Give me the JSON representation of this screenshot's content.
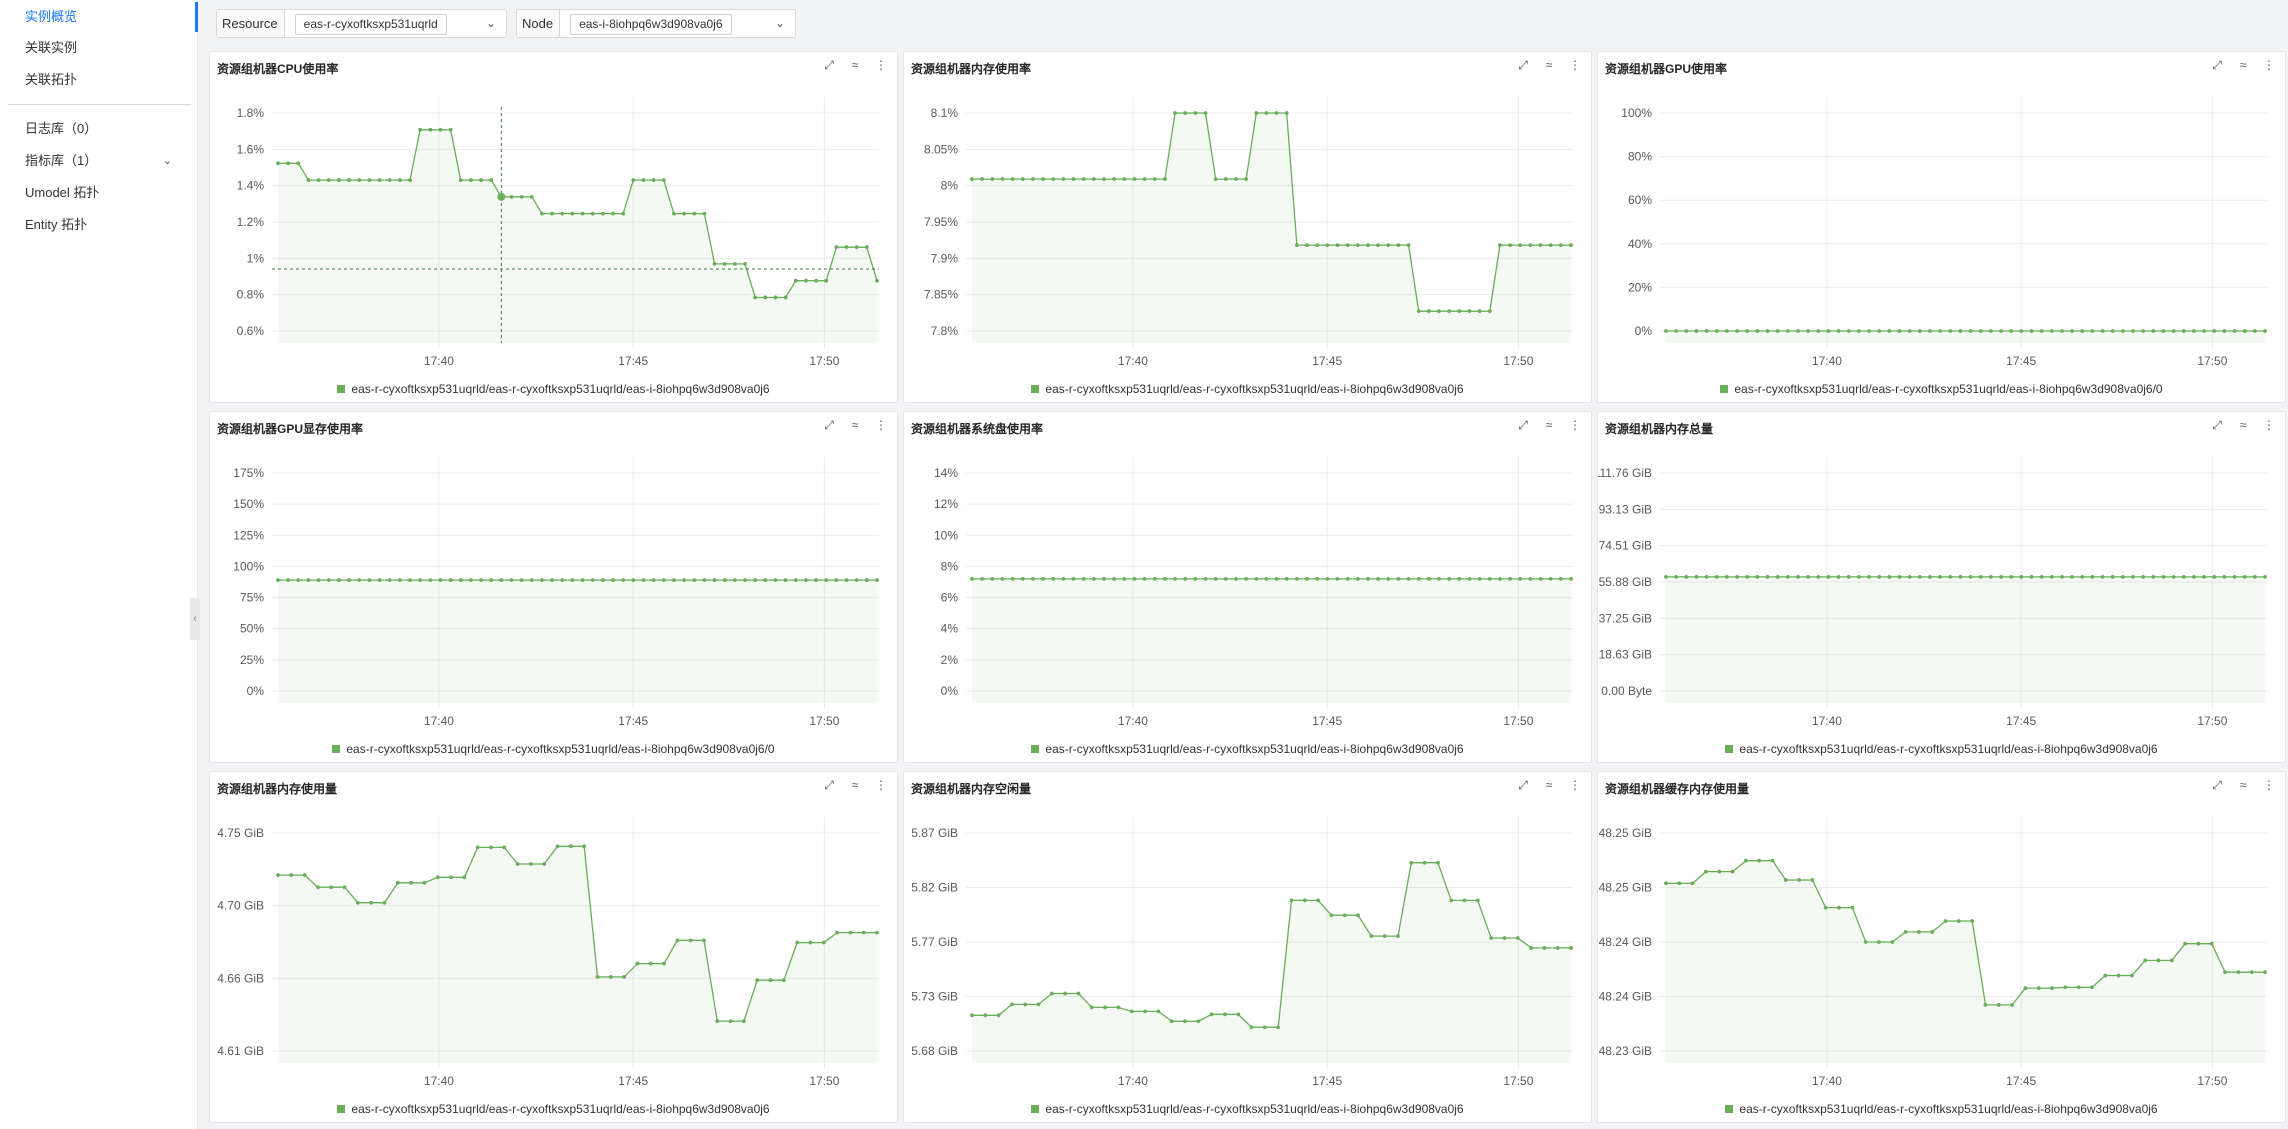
{
  "sidebar": {
    "items": [
      {
        "label": "实例概览",
        "active": true
      },
      {
        "label": "关联实例"
      },
      {
        "label": "关联拓扑"
      },
      {
        "label": "日志库（0）"
      },
      {
        "label": "指标库（1）",
        "expandable": true
      },
      {
        "label": "Umodel 拓扑"
      },
      {
        "label": "Entity 拓扑"
      }
    ]
  },
  "filters": {
    "resource": {
      "label": "Resource",
      "value": "eas-r-cyxoftksxp531uqrld"
    },
    "node": {
      "label": "Node",
      "value": "eas-i-8iohpq6w3d908va0j6"
    }
  },
  "panel_tools": [
    "expand-icon",
    "trend-icon",
    "more-icon"
  ],
  "colors": {
    "series": "#6aad5b",
    "accent": "#1677ff"
  },
  "panels": [
    {
      "title": "资源组机器CPU使用率",
      "legend": "eas-r-cyxoftksxp531uqrld/eas-r-cyxoftksxp531uqrld/eas-i-8iohpq6w3d908va0j6"
    },
    {
      "title": "资源组机器内存使用率",
      "legend": "eas-r-cyxoftksxp531uqrld/eas-r-cyxoftksxp531uqrld/eas-i-8iohpq6w3d908va0j6"
    },
    {
      "title": "资源组机器GPU使用率",
      "legend": "eas-r-cyxoftksxp531uqrld/eas-r-cyxoftksxp531uqrld/eas-i-8iohpq6w3d908va0j6/0"
    },
    {
      "title": "资源组机器GPU显存使用率",
      "legend": "eas-r-cyxoftksxp531uqrld/eas-r-cyxoftksxp531uqrld/eas-i-8iohpq6w3d908va0j6/0"
    },
    {
      "title": "资源组机器系统盘使用率",
      "legend": "eas-r-cyxoftksxp531uqrld/eas-r-cyxoftksxp531uqrld/eas-i-8iohpq6w3d908va0j6"
    },
    {
      "title": "资源组机器内存总量",
      "legend": "eas-r-cyxoftksxp531uqrld/eas-r-cyxoftksxp531uqrld/eas-i-8iohpq6w3d908va0j6"
    },
    {
      "title": "资源组机器内存使用量",
      "legend": "eas-r-cyxoftksxp531uqrld/eas-r-cyxoftksxp531uqrld/eas-i-8iohpq6w3d908va0j6"
    },
    {
      "title": "资源组机器内存空闲量",
      "legend": "eas-r-cyxoftksxp531uqrld/eas-r-cyxoftksxp531uqrld/eas-i-8iohpq6w3d908va0j6"
    },
    {
      "title": "资源组机器缓存内存使用量",
      "legend": "eas-r-cyxoftksxp531uqrld/eas-r-cyxoftksxp531uqrld/eas-i-8iohpq6w3d908va0j6"
    }
  ],
  "chart_data": [
    {
      "type": "area",
      "title": "资源组机器CPU使用率",
      "x": {
        "ticks": [
          "17:40",
          "17:45",
          "17:50"
        ]
      },
      "yticks": [
        "0.6%",
        "0.8%",
        "1%",
        "1.2%",
        "1.4%",
        "1.6%",
        "1.8%"
      ],
      "ylim": [
        0.5,
        1.8
      ],
      "series": [
        {
          "name": "eas-r-cyxoftksxp531uqrld/eas-r-cyxoftksxp531uqrld/eas-i-8iohpq6w3d908va0j6",
          "values": [
            1.5,
            1.5,
            1.5,
            1.4,
            1.4,
            1.4,
            1.4,
            1.4,
            1.4,
            1.4,
            1.4,
            1.4,
            1.4,
            1.4,
            1.7,
            1.7,
            1.7,
            1.7,
            1.4,
            1.4,
            1.4,
            1.4,
            1.3,
            1.3,
            1.3,
            1.3,
            1.2,
            1.2,
            1.2,
            1.2,
            1.2,
            1.2,
            1.2,
            1.2,
            1.2,
            1.4,
            1.4,
            1.4,
            1.4,
            1.2,
            1.2,
            1.2,
            1.2,
            0.9,
            0.9,
            0.9,
            0.9,
            0.7,
            0.7,
            0.7,
            0.7,
            0.8,
            0.8,
            0.8,
            0.8,
            1.0,
            1.0,
            1.0,
            1.0,
            0.8
          ]
        }
      ],
      "crosshair": {
        "value_y": 0.87
      }
    },
    {
      "type": "area",
      "title": "资源组机器内存使用率",
      "x": {
        "ticks": [
          "17:40",
          "17:45",
          "17:50"
        ]
      },
      "yticks": [
        "7.8%",
        "7.85%",
        "7.9%",
        "7.95%",
        "8%",
        "8.05%",
        "8.1%"
      ],
      "ylim": [
        7.77,
        8.1
      ],
      "series": [
        {
          "name": "eas-r-cyxoftksxp531uqrld/eas-r-cyxoftksxp531uqrld/eas-i-8iohpq6w3d908va0j6",
          "values": [
            8.0,
            8.0,
            8.0,
            8.0,
            8.0,
            8.0,
            8.0,
            8.0,
            8.0,
            8.0,
            8.0,
            8.0,
            8.0,
            8.0,
            8.0,
            8.0,
            8.0,
            8.0,
            8.0,
            8.0,
            8.1,
            8.1,
            8.1,
            8.1,
            8.0,
            8.0,
            8.0,
            8.0,
            8.1,
            8.1,
            8.1,
            8.1,
            7.9,
            7.9,
            7.9,
            7.9,
            7.9,
            7.9,
            7.9,
            7.9,
            7.9,
            7.9,
            7.9,
            7.9,
            7.8,
            7.8,
            7.8,
            7.8,
            7.8,
            7.8,
            7.8,
            7.8,
            7.9,
            7.9,
            7.9,
            7.9,
            7.9,
            7.9,
            7.9,
            7.9
          ]
        }
      ]
    },
    {
      "type": "area",
      "title": "资源组机器GPU使用率",
      "x": {
        "ticks": [
          "17:40",
          "17:45",
          "17:50"
        ]
      },
      "yticks": [
        "0%",
        "20%",
        "40%",
        "60%",
        "80%",
        "100%"
      ],
      "ylim": [
        0,
        100
      ],
      "series": [
        {
          "name": "eas-r-cyxoftksxp531uqrld/eas-r-cyxoftksxp531uqrld/eas-i-8iohpq6w3d908va0j6/0",
          "values": [
            0,
            0,
            0,
            0,
            0,
            0,
            0,
            0,
            0,
            0,
            0,
            0,
            0,
            0,
            0,
            0,
            0,
            0,
            0,
            0,
            0,
            0,
            0,
            0,
            0,
            0,
            0,
            0,
            0,
            0,
            0,
            0,
            0,
            0,
            0,
            0,
            0,
            0,
            0,
            0,
            0,
            0,
            0,
            0,
            0,
            0,
            0,
            0,
            0,
            0,
            0,
            0,
            0,
            0,
            0,
            0,
            0,
            0,
            0,
            0
          ]
        }
      ]
    },
    {
      "type": "area",
      "title": "资源组机器GPU显存使用率",
      "x": {
        "ticks": [
          "17:40",
          "17:45",
          "17:50"
        ]
      },
      "yticks": [
        "0%",
        "25%",
        "50%",
        "75%",
        "100%",
        "125%",
        "150%",
        "175%"
      ],
      "ylim": [
        0,
        175
      ],
      "series": [
        {
          "name": "eas-r-cyxoftksxp531uqrld/eas-r-cyxoftksxp531uqrld/eas-i-8iohpq6w3d908va0j6/0",
          "values": [
            89,
            89,
            89,
            89,
            89,
            89,
            89,
            89,
            89,
            89,
            89,
            89,
            89,
            89,
            89,
            89,
            89,
            89,
            89,
            89,
            89,
            89,
            89,
            89,
            89,
            89,
            89,
            89,
            89,
            89,
            89,
            89,
            89,
            89,
            89,
            89,
            89,
            89,
            89,
            89,
            89,
            89,
            89,
            89,
            89,
            89,
            89,
            89,
            89,
            89,
            89,
            89,
            89,
            89,
            89,
            89,
            89,
            89,
            89,
            89
          ]
        }
      ]
    },
    {
      "type": "area",
      "title": "资源组机器系统盘使用率",
      "x": {
        "ticks": [
          "17:40",
          "17:45",
          "17:50"
        ]
      },
      "yticks": [
        "0%",
        "2%",
        "4%",
        "6%",
        "8%",
        "10%",
        "12%",
        "14%"
      ],
      "ylim": [
        0,
        14
      ],
      "series": [
        {
          "name": "eas-r-cyxoftksxp531uqrld/eas-r-cyxoftksxp531uqrld/eas-i-8iohpq6w3d908va0j6",
          "values": [
            7.2,
            7.2,
            7.2,
            7.2,
            7.2,
            7.2,
            7.2,
            7.2,
            7.2,
            7.2,
            7.2,
            7.2,
            7.2,
            7.2,
            7.2,
            7.2,
            7.2,
            7.2,
            7.2,
            7.2,
            7.2,
            7.2,
            7.2,
            7.2,
            7.2,
            7.2,
            7.2,
            7.2,
            7.2,
            7.2,
            7.2,
            7.2,
            7.2,
            7.2,
            7.2,
            7.2,
            7.2,
            7.2,
            7.2,
            7.2,
            7.2,
            7.2,
            7.2,
            7.2,
            7.2,
            7.2,
            7.2,
            7.2,
            7.2,
            7.2,
            7.2,
            7.2,
            7.2,
            7.2,
            7.2,
            7.2,
            7.2,
            7.2,
            7.2,
            7.2
          ]
        }
      ]
    },
    {
      "type": "area",
      "title": "资源组机器内存总量",
      "x": {
        "ticks": [
          "17:40",
          "17:45",
          "17:50"
        ]
      },
      "yticks": [
        "0.00 Byte",
        "18.63 GiB",
        "37.25 GiB",
        "55.88 GiB",
        "74.51 GiB",
        "93.13 GiB",
        "111.76 GiB"
      ],
      "ylim": [
        0,
        111.76
      ],
      "series": [
        {
          "name": "eas-r-cyxoftksxp531uqrld/eas-r-cyxoftksxp531uqrld/eas-i-8iohpq6w3d908va0j6",
          "values": [
            58.5,
            58.5,
            58.5,
            58.5,
            58.5,
            58.5,
            58.5,
            58.5,
            58.5,
            58.5,
            58.5,
            58.5,
            58.5,
            58.5,
            58.5,
            58.5,
            58.5,
            58.5,
            58.5,
            58.5,
            58.5,
            58.5,
            58.5,
            58.5,
            58.5,
            58.5,
            58.5,
            58.5,
            58.5,
            58.5,
            58.5,
            58.5,
            58.5,
            58.5,
            58.5,
            58.5,
            58.5,
            58.5,
            58.5,
            58.5,
            58.5,
            58.5,
            58.5,
            58.5,
            58.5,
            58.5,
            58.5,
            58.5,
            58.5,
            58.5,
            58.5,
            58.5,
            58.5,
            58.5,
            58.5,
            58.5,
            58.5,
            58.5,
            58.5,
            58.5
          ]
        }
      ]
    },
    {
      "type": "area",
      "title": "资源组机器内存使用量",
      "x": {
        "ticks": [
          "17:40",
          "17:45",
          "17:50"
        ]
      },
      "yticks": [
        "4.61 GiB",
        "4.66 GiB",
        "4.70 GiB",
        "4.75 GiB"
      ],
      "ylim": [
        4.573,
        4.77
      ],
      "series": [
        {
          "name": "eas-r-cyxoftksxp531uqrld/eas-r-cyxoftksxp531uqrld/eas-i-8iohpq6w3d908va0j6",
          "values": [
            4.732,
            4.732,
            4.732,
            4.721,
            4.721,
            4.721,
            4.707,
            4.707,
            4.707,
            4.725,
            4.725,
            4.725,
            4.73,
            4.73,
            4.73,
            4.757,
            4.757,
            4.757,
            4.742,
            4.742,
            4.742,
            4.758,
            4.758,
            4.758,
            4.64,
            4.64,
            4.64,
            4.652,
            4.652,
            4.652,
            4.673,
            4.673,
            4.673,
            4.6,
            4.6,
            4.6,
            4.637,
            4.637,
            4.637,
            4.671,
            4.671,
            4.671,
            4.68,
            4.68,
            4.68,
            4.68
          ]
        }
      ]
    },
    {
      "type": "area",
      "title": "资源组机器内存空闲量",
      "x": {
        "ticks": [
          "17:40",
          "17:45",
          "17:50"
        ]
      },
      "yticks": [
        "5.68 GiB",
        "5.73 GiB",
        "5.77 GiB",
        "5.82 GiB",
        "5.87 GiB"
      ],
      "ylim": [
        5.66,
        5.88
      ],
      "series": [
        {
          "name": "eas-r-cyxoftksxp531uqrld/eas-r-cyxoftksxp531uqrld/eas-i-8iohpq6w3d908va0j6",
          "values": [
            5.696,
            5.696,
            5.696,
            5.707,
            5.707,
            5.707,
            5.718,
            5.718,
            5.718,
            5.704,
            5.704,
            5.704,
            5.7,
            5.7,
            5.7,
            5.69,
            5.69,
            5.69,
            5.697,
            5.697,
            5.697,
            5.684,
            5.684,
            5.684,
            5.812,
            5.812,
            5.812,
            5.797,
            5.797,
            5.797,
            5.776,
            5.776,
            5.776,
            5.85,
            5.85,
            5.85,
            5.812,
            5.812,
            5.812,
            5.774,
            5.774,
            5.774,
            5.764,
            5.764,
            5.764,
            5.764
          ]
        }
      ]
    },
    {
      "type": "area",
      "title": "资源组机器缓存内存使用量",
      "x": {
        "ticks": [
          "17:40",
          "17:45",
          "17:50"
        ]
      },
      "yticks": [
        "48.23 GiB",
        "48.24 GiB",
        "48.24 GiB",
        "48.25 GiB",
        "48.25 GiB"
      ],
      "ylim": [
        48.227,
        48.253
      ],
      "series": [
        {
          "name": "eas-r-cyxoftksxp531uqrld/eas-r-cyxoftksxp531uqrld/eas-i-8iohpq6w3d908va0j6",
          "values": [
            48.247,
            48.247,
            48.247,
            48.2484,
            48.2484,
            48.2484,
            48.2497,
            48.2497,
            48.2497,
            48.2474,
            48.2474,
            48.2474,
            48.2441,
            48.2441,
            48.2441,
            48.24,
            48.24,
            48.24,
            48.2412,
            48.2412,
            48.2412,
            48.2425,
            48.2425,
            48.2425,
            48.2325,
            48.2325,
            48.2325,
            48.2345,
            48.2345,
            48.2345,
            48.2346,
            48.2346,
            48.2346,
            48.236,
            48.236,
            48.236,
            48.2378,
            48.2378,
            48.2378,
            48.2398,
            48.2398,
            48.2398,
            48.2364,
            48.2364,
            48.2364,
            48.2364
          ]
        }
      ]
    }
  ]
}
